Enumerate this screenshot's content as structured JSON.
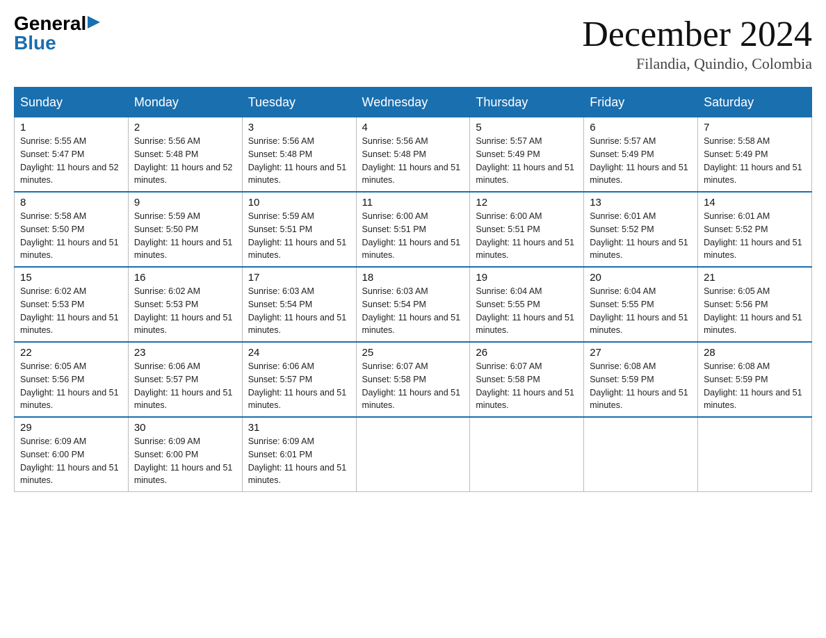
{
  "logo": {
    "general": "General",
    "blue": "Blue",
    "arrow": "▶"
  },
  "title": {
    "month": "December 2024",
    "location": "Filandia, Quindio, Colombia"
  },
  "weekdays": [
    "Sunday",
    "Monday",
    "Tuesday",
    "Wednesday",
    "Thursday",
    "Friday",
    "Saturday"
  ],
  "weeks": [
    [
      {
        "day": "1",
        "sunrise": "5:55 AM",
        "sunset": "5:47 PM",
        "daylight": "11 hours and 52 minutes."
      },
      {
        "day": "2",
        "sunrise": "5:56 AM",
        "sunset": "5:48 PM",
        "daylight": "11 hours and 52 minutes."
      },
      {
        "day": "3",
        "sunrise": "5:56 AM",
        "sunset": "5:48 PM",
        "daylight": "11 hours and 51 minutes."
      },
      {
        "day": "4",
        "sunrise": "5:56 AM",
        "sunset": "5:48 PM",
        "daylight": "11 hours and 51 minutes."
      },
      {
        "day": "5",
        "sunrise": "5:57 AM",
        "sunset": "5:49 PM",
        "daylight": "11 hours and 51 minutes."
      },
      {
        "day": "6",
        "sunrise": "5:57 AM",
        "sunset": "5:49 PM",
        "daylight": "11 hours and 51 minutes."
      },
      {
        "day": "7",
        "sunrise": "5:58 AM",
        "sunset": "5:49 PM",
        "daylight": "11 hours and 51 minutes."
      }
    ],
    [
      {
        "day": "8",
        "sunrise": "5:58 AM",
        "sunset": "5:50 PM",
        "daylight": "11 hours and 51 minutes."
      },
      {
        "day": "9",
        "sunrise": "5:59 AM",
        "sunset": "5:50 PM",
        "daylight": "11 hours and 51 minutes."
      },
      {
        "day": "10",
        "sunrise": "5:59 AM",
        "sunset": "5:51 PM",
        "daylight": "11 hours and 51 minutes."
      },
      {
        "day": "11",
        "sunrise": "6:00 AM",
        "sunset": "5:51 PM",
        "daylight": "11 hours and 51 minutes."
      },
      {
        "day": "12",
        "sunrise": "6:00 AM",
        "sunset": "5:51 PM",
        "daylight": "11 hours and 51 minutes."
      },
      {
        "day": "13",
        "sunrise": "6:01 AM",
        "sunset": "5:52 PM",
        "daylight": "11 hours and 51 minutes."
      },
      {
        "day": "14",
        "sunrise": "6:01 AM",
        "sunset": "5:52 PM",
        "daylight": "11 hours and 51 minutes."
      }
    ],
    [
      {
        "day": "15",
        "sunrise": "6:02 AM",
        "sunset": "5:53 PM",
        "daylight": "11 hours and 51 minutes."
      },
      {
        "day": "16",
        "sunrise": "6:02 AM",
        "sunset": "5:53 PM",
        "daylight": "11 hours and 51 minutes."
      },
      {
        "day": "17",
        "sunrise": "6:03 AM",
        "sunset": "5:54 PM",
        "daylight": "11 hours and 51 minutes."
      },
      {
        "day": "18",
        "sunrise": "6:03 AM",
        "sunset": "5:54 PM",
        "daylight": "11 hours and 51 minutes."
      },
      {
        "day": "19",
        "sunrise": "6:04 AM",
        "sunset": "5:55 PM",
        "daylight": "11 hours and 51 minutes."
      },
      {
        "day": "20",
        "sunrise": "6:04 AM",
        "sunset": "5:55 PM",
        "daylight": "11 hours and 51 minutes."
      },
      {
        "day": "21",
        "sunrise": "6:05 AM",
        "sunset": "5:56 PM",
        "daylight": "11 hours and 51 minutes."
      }
    ],
    [
      {
        "day": "22",
        "sunrise": "6:05 AM",
        "sunset": "5:56 PM",
        "daylight": "11 hours and 51 minutes."
      },
      {
        "day": "23",
        "sunrise": "6:06 AM",
        "sunset": "5:57 PM",
        "daylight": "11 hours and 51 minutes."
      },
      {
        "day": "24",
        "sunrise": "6:06 AM",
        "sunset": "5:57 PM",
        "daylight": "11 hours and 51 minutes."
      },
      {
        "day": "25",
        "sunrise": "6:07 AM",
        "sunset": "5:58 PM",
        "daylight": "11 hours and 51 minutes."
      },
      {
        "day": "26",
        "sunrise": "6:07 AM",
        "sunset": "5:58 PM",
        "daylight": "11 hours and 51 minutes."
      },
      {
        "day": "27",
        "sunrise": "6:08 AM",
        "sunset": "5:59 PM",
        "daylight": "11 hours and 51 minutes."
      },
      {
        "day": "28",
        "sunrise": "6:08 AM",
        "sunset": "5:59 PM",
        "daylight": "11 hours and 51 minutes."
      }
    ],
    [
      {
        "day": "29",
        "sunrise": "6:09 AM",
        "sunset": "6:00 PM",
        "daylight": "11 hours and 51 minutes."
      },
      {
        "day": "30",
        "sunrise": "6:09 AM",
        "sunset": "6:00 PM",
        "daylight": "11 hours and 51 minutes."
      },
      {
        "day": "31",
        "sunrise": "6:09 AM",
        "sunset": "6:01 PM",
        "daylight": "11 hours and 51 minutes."
      },
      null,
      null,
      null,
      null
    ]
  ]
}
